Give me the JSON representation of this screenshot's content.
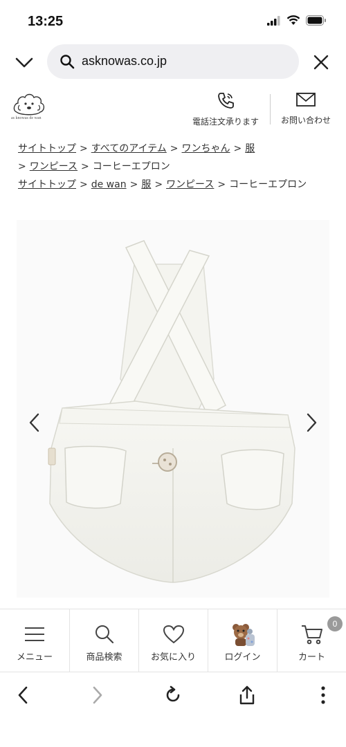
{
  "status_bar": {
    "time": "13:25"
  },
  "browser": {
    "url": "asknowas.co.jp"
  },
  "site": {
    "logo_text": "as knowas de wan",
    "phone_order_label": "電話注文承ります",
    "contact_label": "お問い合わせ"
  },
  "breadcrumbs": {
    "line1": [
      "サイトトップ",
      "すべてのアイテム",
      "ワンちゃん",
      "服"
    ],
    "line2_link": "ワンピース",
    "line2_current": "コーヒーエプロン",
    "line3": [
      "サイトトップ",
      "de wan",
      "服",
      "ワンピース"
    ],
    "line3_current": "コーヒーエプロン",
    "separator": ">"
  },
  "bottom_nav": {
    "menu": "メニュー",
    "search": "商品検索",
    "favorites": "お気に入り",
    "login": "ログイン",
    "cart": "カート",
    "cart_count": "0"
  },
  "colors": {
    "accent_gray": "#9a9a9a",
    "pill": "#efeff2"
  }
}
